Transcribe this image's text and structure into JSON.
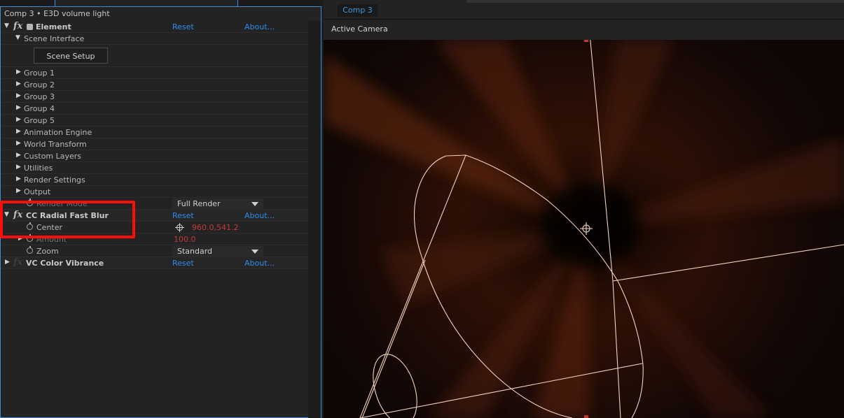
{
  "effect_controls": {
    "title": "Comp 3 • E3D volume light",
    "element": {
      "name": "Element",
      "reset": "Reset",
      "about": "About...",
      "scene_interface": "Scene Interface",
      "scene_setup_button": "Scene Setup",
      "groups": [
        "Group 1",
        "Group 2",
        "Group 3",
        "Group 4",
        "Group 5",
        "Animation Engine",
        "World Transform",
        "Custom Layers",
        "Utilities",
        "Render Settings",
        "Output"
      ],
      "render_mode_label": "Render Mode",
      "render_mode_value": "Full Render"
    },
    "cc_radial_fast_blur": {
      "name": "CC Radial Fast Blur",
      "reset": "Reset",
      "about": "About...",
      "center_label": "Center",
      "center_value": "960.0,541.2",
      "amount_label": "Amount",
      "amount_value": "100.0",
      "zoom_label": "Zoom",
      "zoom_value": "Standard"
    },
    "vc_color_vibrance": {
      "name": "VC Color Vibrance",
      "reset": "Reset",
      "about": "About..."
    }
  },
  "composition": {
    "tab": "Comp 3",
    "view_label": "Active Camera"
  },
  "colors": {
    "accent_blue": "#2d8ceb",
    "highlight_red": "#ff0d0d",
    "value_red": "#c43a3a"
  }
}
